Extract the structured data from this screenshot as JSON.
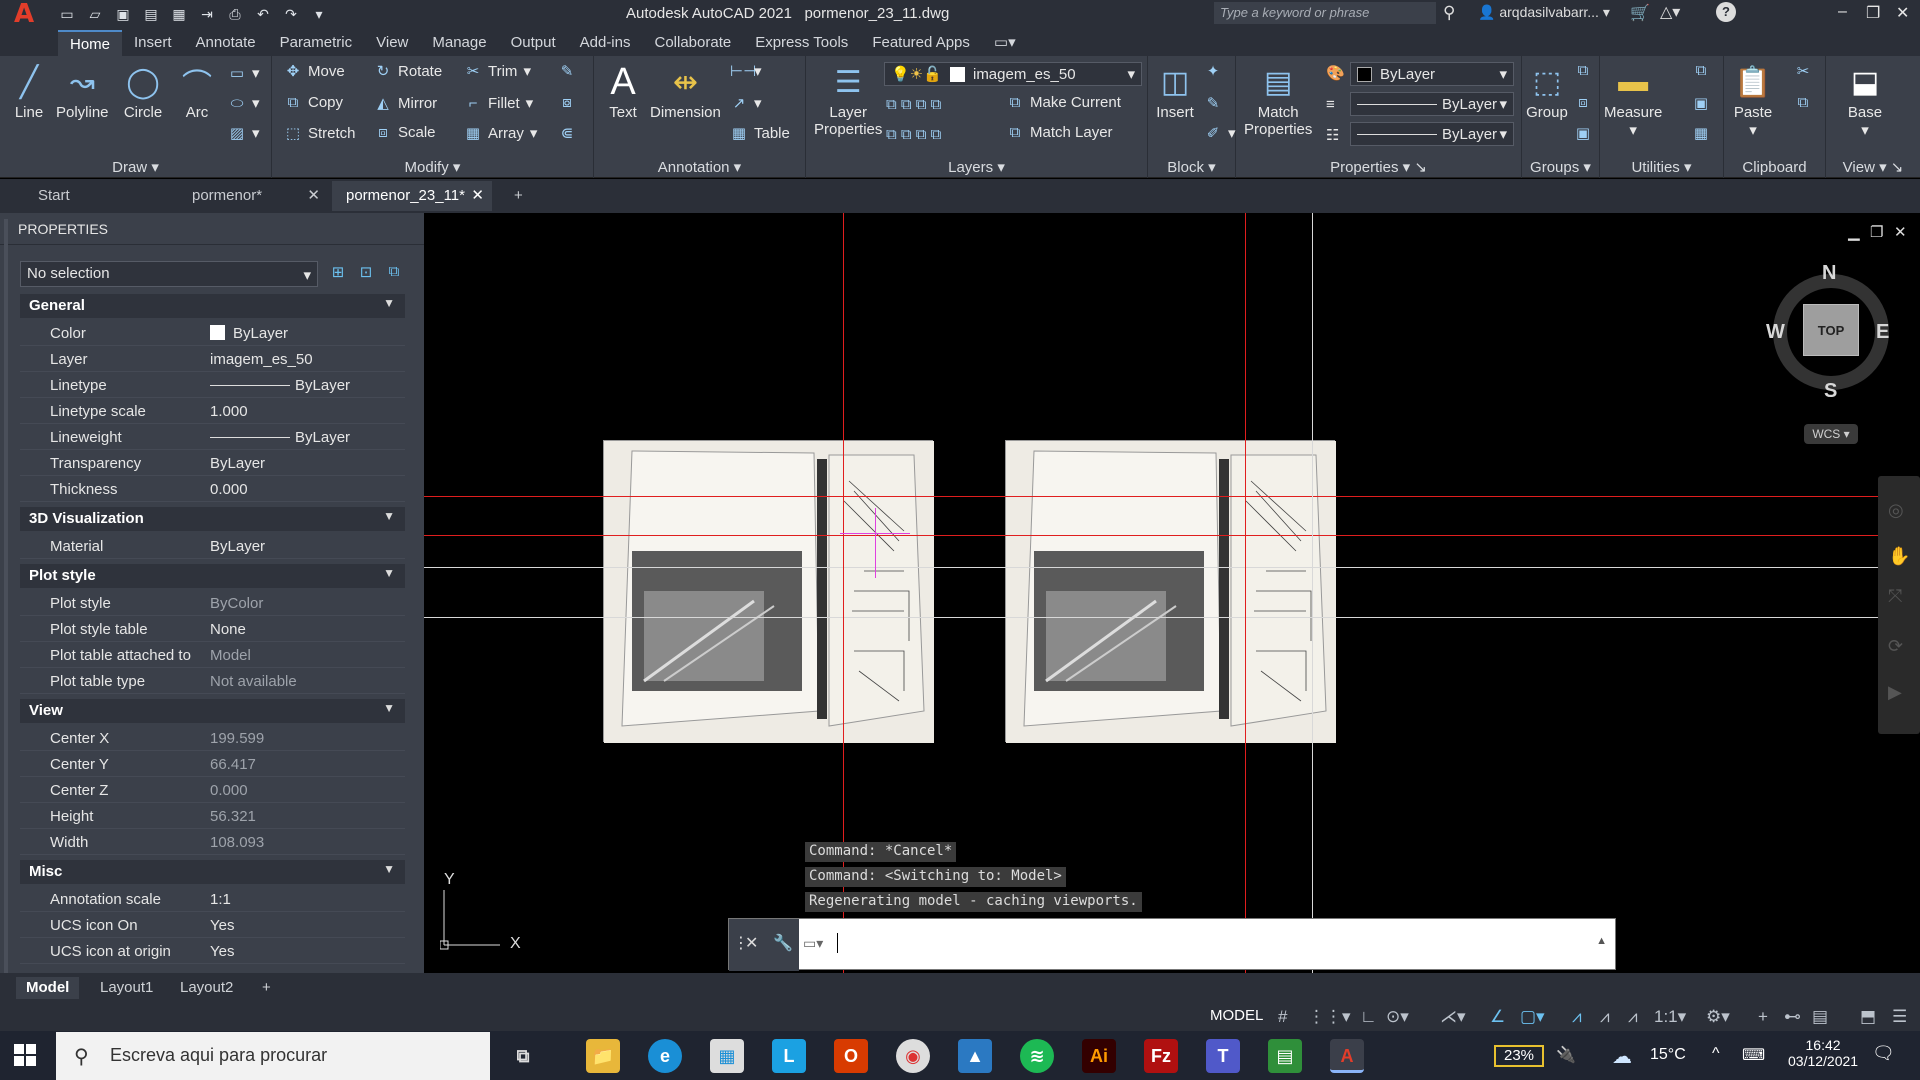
{
  "titlebar": {
    "logo": "A",
    "app_title": "Autodesk AutoCAD 2021",
    "file_name": "pormenor_23_11.dwg",
    "search_placeholder": "Type a keyword or phrase",
    "user": "arqdasilvabarr..."
  },
  "ribbon_tabs": [
    "Home",
    "Insert",
    "Annotate",
    "Parametric",
    "View",
    "Manage",
    "Output",
    "Add-ins",
    "Collaborate",
    "Express Tools",
    "Featured Apps"
  ],
  "ribbon": {
    "draw": {
      "title": "Draw",
      "line": "Line",
      "polyline": "Polyline",
      "circle": "Circle",
      "arc": "Arc"
    },
    "modify": {
      "title": "Modify",
      "move": "Move",
      "rotate": "Rotate",
      "trim": "Trim",
      "copy": "Copy",
      "mirror": "Mirror",
      "fillet": "Fillet",
      "stretch": "Stretch",
      "scale": "Scale",
      "array": "Array"
    },
    "annotation": {
      "title": "Annotation",
      "text": "Text",
      "dimension": "Dimension",
      "table": "Table"
    },
    "layers": {
      "title": "Layers",
      "layer_properties_1": "Layer",
      "layer_properties_2": "Properties",
      "current_layer": "imagem_es_50",
      "make_current": "Make Current",
      "match_layer": "Match Layer"
    },
    "block": {
      "title": "Block",
      "insert": "Insert"
    },
    "properties": {
      "title": "Properties",
      "match_1": "Match",
      "match_2": "Properties",
      "color": "ByLayer",
      "lineweight": "ByLayer",
      "linetype": "ByLayer"
    },
    "groups": {
      "title": "Groups",
      "group": "Group"
    },
    "utilities": {
      "title": "Utilities",
      "measure": "Measure"
    },
    "clipboard": {
      "title": "Clipboard",
      "paste": "Paste"
    },
    "view": {
      "title": "View",
      "base": "Base"
    }
  },
  "doc_tabs": [
    "Start",
    "pormenor*",
    "pormenor_23_11*"
  ],
  "properties": {
    "header": "PROPERTIES",
    "selection": "No selection",
    "sections": {
      "general": "General",
      "visualization": "3D Visualization",
      "plot_style": "Plot style",
      "view": "View",
      "misc": "Misc"
    },
    "general": [
      {
        "k": "Color",
        "v": "ByLayer"
      },
      {
        "k": "Layer",
        "v": "imagem_es_50"
      },
      {
        "k": "Linetype",
        "v": "ByLayer"
      },
      {
        "k": "Linetype scale",
        "v": "1.000"
      },
      {
        "k": "Lineweight",
        "v": "ByLayer"
      },
      {
        "k": "Transparency",
        "v": "ByLayer"
      },
      {
        "k": "Thickness",
        "v": "0.000"
      }
    ],
    "visualization": [
      {
        "k": "Material",
        "v": "ByLayer"
      }
    ],
    "plot_style": [
      {
        "k": "Plot style",
        "v": "ByColor"
      },
      {
        "k": "Plot style table",
        "v": "None"
      },
      {
        "k": "Plot table attached to",
        "v": "Model"
      },
      {
        "k": "Plot table type",
        "v": "Not available"
      }
    ],
    "view": [
      {
        "k": "Center X",
        "v": "199.599"
      },
      {
        "k": "Center Y",
        "v": "66.417"
      },
      {
        "k": "Center Z",
        "v": "0.000"
      },
      {
        "k": "Height",
        "v": "56.321"
      },
      {
        "k": "Width",
        "v": "108.093"
      }
    ],
    "misc": [
      {
        "k": "Annotation scale",
        "v": "1:1"
      },
      {
        "k": "UCS icon On",
        "v": "Yes"
      },
      {
        "k": "UCS icon at origin",
        "v": "Yes"
      }
    ]
  },
  "viewcube": {
    "n": "N",
    "s": "S",
    "e": "E",
    "w": "W",
    "top": "TOP",
    "wcs": "WCS"
  },
  "ucs": {
    "y": "Y",
    "x": "X"
  },
  "command_history": [
    "Command: *Cancel*",
    "Command:   <Switching to: Model>",
    "Regenerating model - caching viewports."
  ],
  "layout_tabs": [
    "Model",
    "Layout1",
    "Layout2"
  ],
  "statusbar": {
    "model": "MODEL",
    "scale": "1:1"
  },
  "taskbar": {
    "search": "Escreva aqui para procurar",
    "battery": "23%",
    "temperature": "15°C",
    "time": "16:42",
    "date": "03/12/2021",
    "apps": [
      "L",
      "Ai",
      "A"
    ]
  }
}
